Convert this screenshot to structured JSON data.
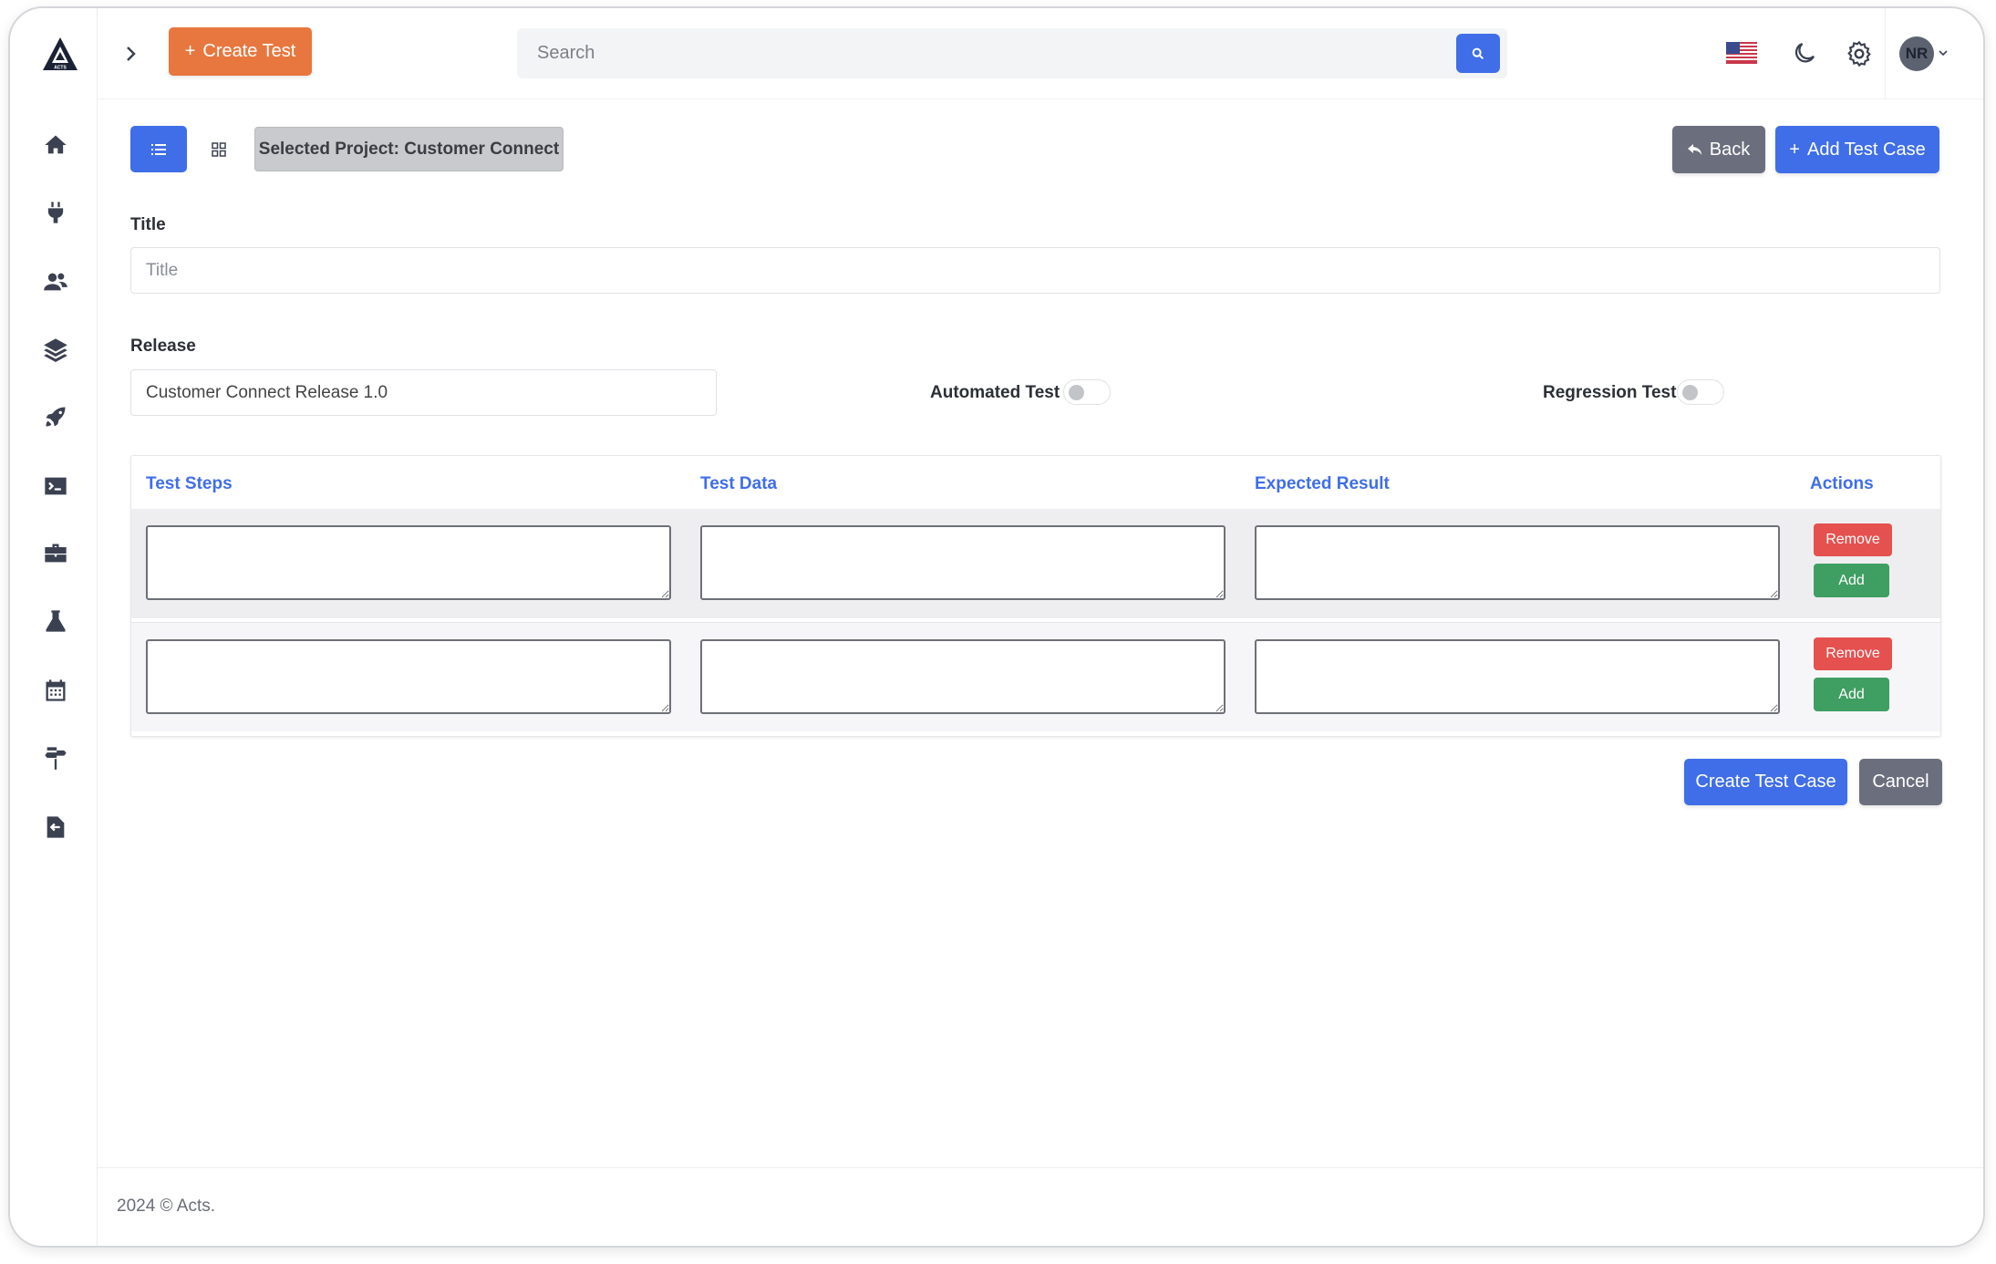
{
  "app": {
    "logo_text": "ACTS"
  },
  "sidebar": {
    "items": [
      {
        "icon": "home-icon"
      },
      {
        "icon": "plug-icon"
      },
      {
        "icon": "users-icon"
      },
      {
        "icon": "layers-icon"
      },
      {
        "icon": "rocket-icon"
      },
      {
        "icon": "terminal-icon"
      },
      {
        "icon": "briefcase-icon"
      },
      {
        "icon": "flask-icon"
      },
      {
        "icon": "calendar-icon"
      },
      {
        "icon": "signpost-icon"
      },
      {
        "icon": "file-import-icon"
      }
    ]
  },
  "topbar": {
    "create_test_label": "Create Test",
    "search_placeholder": "Search",
    "avatar_initials": "NR"
  },
  "toolbar": {
    "selected_project": "Selected Project: Customer Connect",
    "back_label": "Back",
    "add_test_case_label": "Add Test Case"
  },
  "form": {
    "title_label": "Title",
    "title_placeholder": "Title",
    "title_value": "",
    "release_label": "Release",
    "release_value": "Customer Connect Release 1.0",
    "automated_test_label": "Automated Test",
    "automated_test_on": false,
    "regression_test_label": "Regression Test",
    "regression_test_on": false
  },
  "steps_table": {
    "headers": [
      "Test Steps",
      "Test Data",
      "Expected Result",
      "Actions"
    ],
    "rows": [
      {
        "test_step": "",
        "test_data": "",
        "expected_result": "",
        "remove_label": "Remove",
        "add_label": "Add"
      },
      {
        "test_step": "",
        "test_data": "",
        "expected_result": "",
        "remove_label": "Remove",
        "add_label": "Add"
      }
    ]
  },
  "actions": {
    "create_test_case_label": "Create Test Case",
    "cancel_label": "Cancel"
  },
  "footer": {
    "text": "2024 © Acts."
  },
  "colors": {
    "primary": "#3f6ee8",
    "orange": "#e8773f",
    "danger": "#e5514f",
    "success": "#3f9e62",
    "secondary": "#6b6f7d"
  }
}
